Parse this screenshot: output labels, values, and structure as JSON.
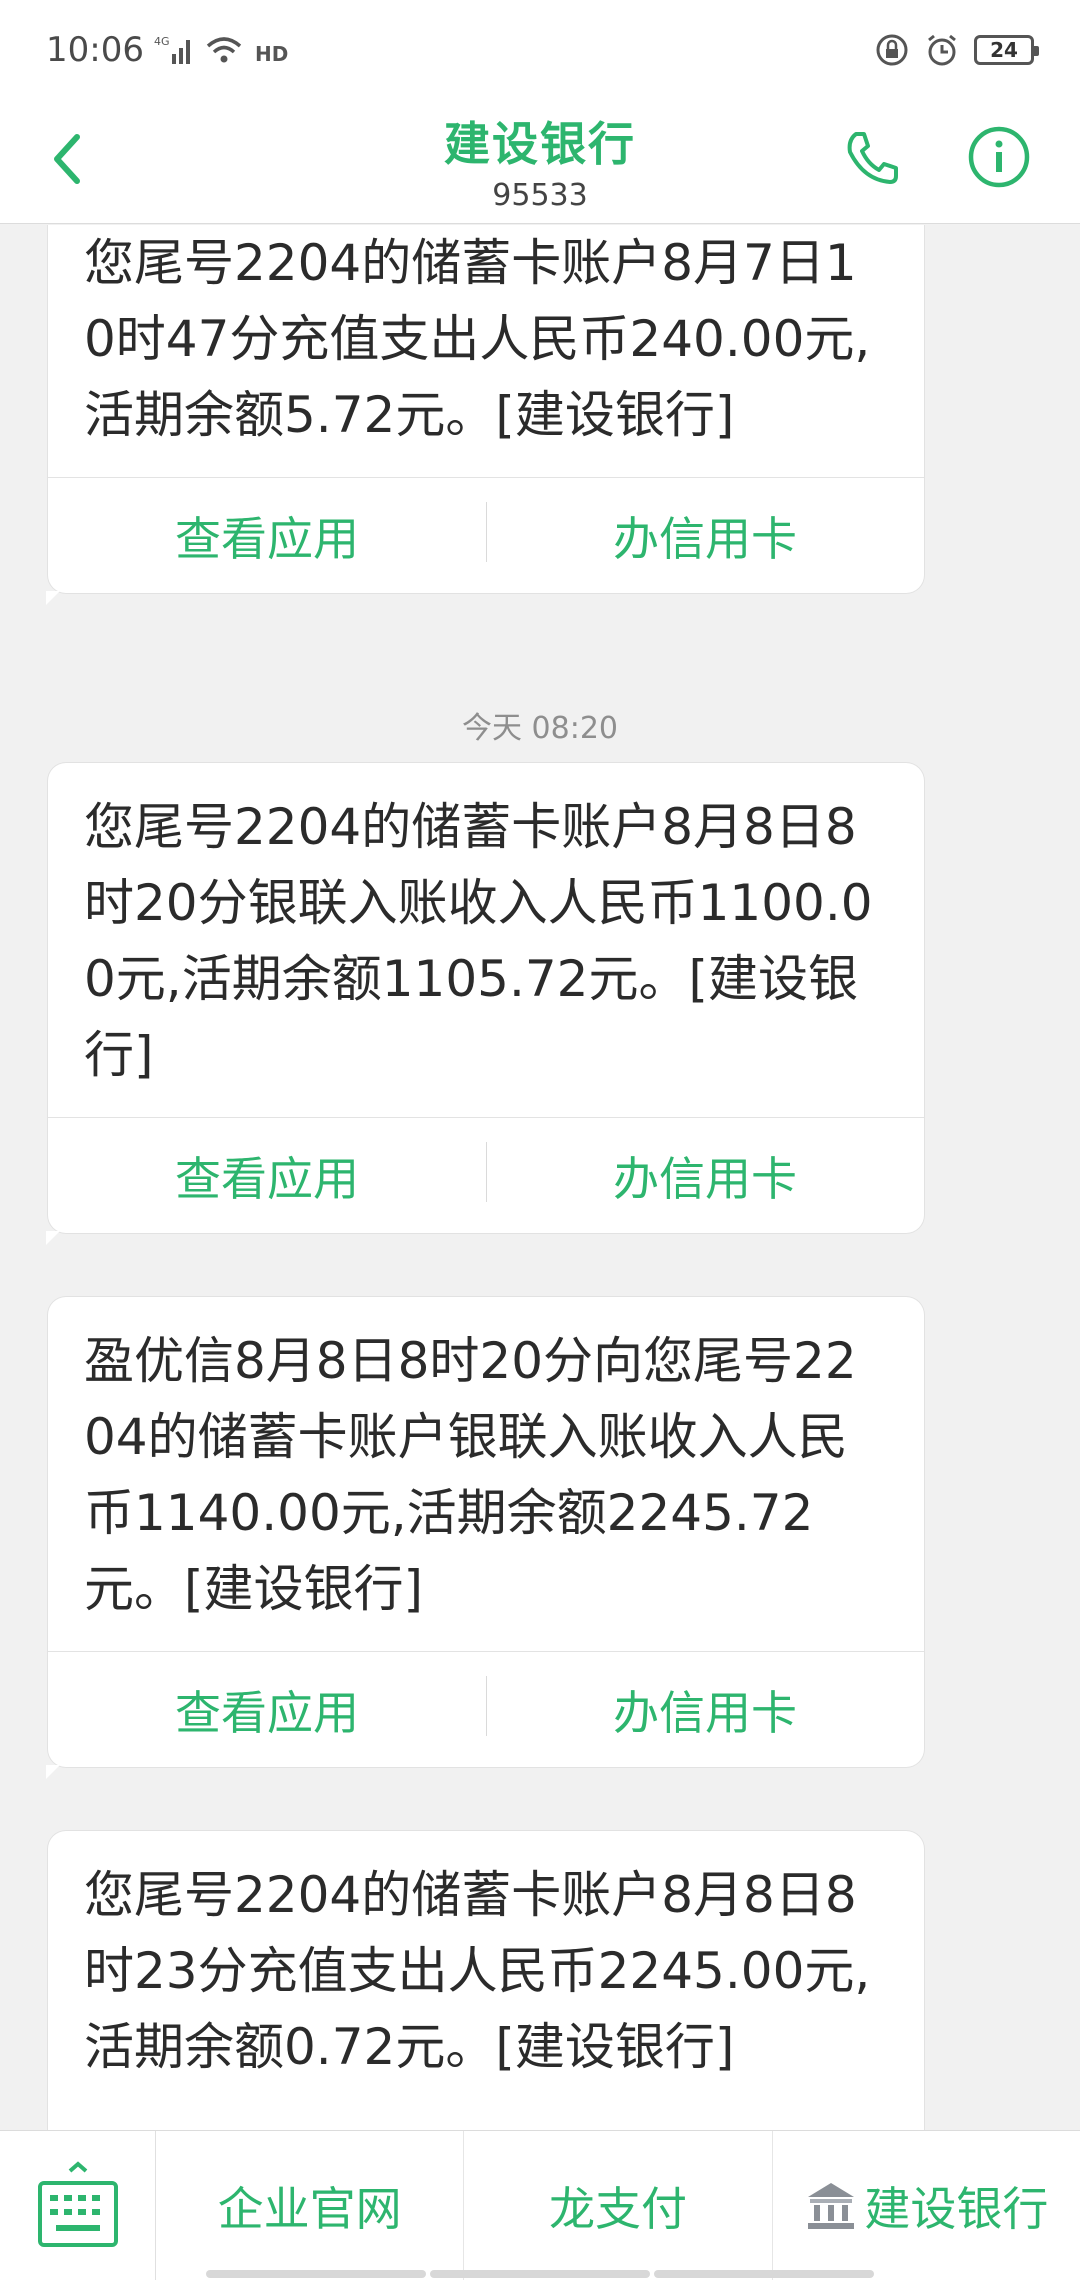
{
  "status_bar": {
    "time": "10:06",
    "network": "4G",
    "hd": "HD",
    "battery": "24"
  },
  "header": {
    "title": "建设银行",
    "number": "95533"
  },
  "messages": [
    {
      "text": "您尾号2204的储蓄卡账户8月7日10时47分充值支出人民币240.00元,活期余额5.72元。[建设银行]",
      "actions": [
        "查看应用",
        "办信用卡"
      ]
    },
    {
      "timestamp": "今天 08:20",
      "text": "您尾号2204的储蓄卡账户8月8日8时20分银联入账收入人民币1100.00元,活期余额1105.72元。[建设银行]",
      "actions": [
        "查看应用",
        "办信用卡"
      ]
    },
    {
      "text": "盈优信8月8日8时20分向您尾号2204的储蓄卡账户银联入账收入人民币1140.00元,活期余额2245.72元。[建设银行]",
      "actions": [
        "查看应用",
        "办信用卡"
      ]
    },
    {
      "text": "您尾号2204的储蓄卡账户8月8日8时23分充值支出人民币2245.00元,活期余额0.72元。[建设银行]"
    }
  ],
  "bottom_menu": {
    "items": [
      "企业官网",
      "龙支付",
      "建设银行"
    ]
  },
  "colors": {
    "accent": "#2db56e",
    "background": "#f1f1f1",
    "bubble": "#ffffff"
  }
}
